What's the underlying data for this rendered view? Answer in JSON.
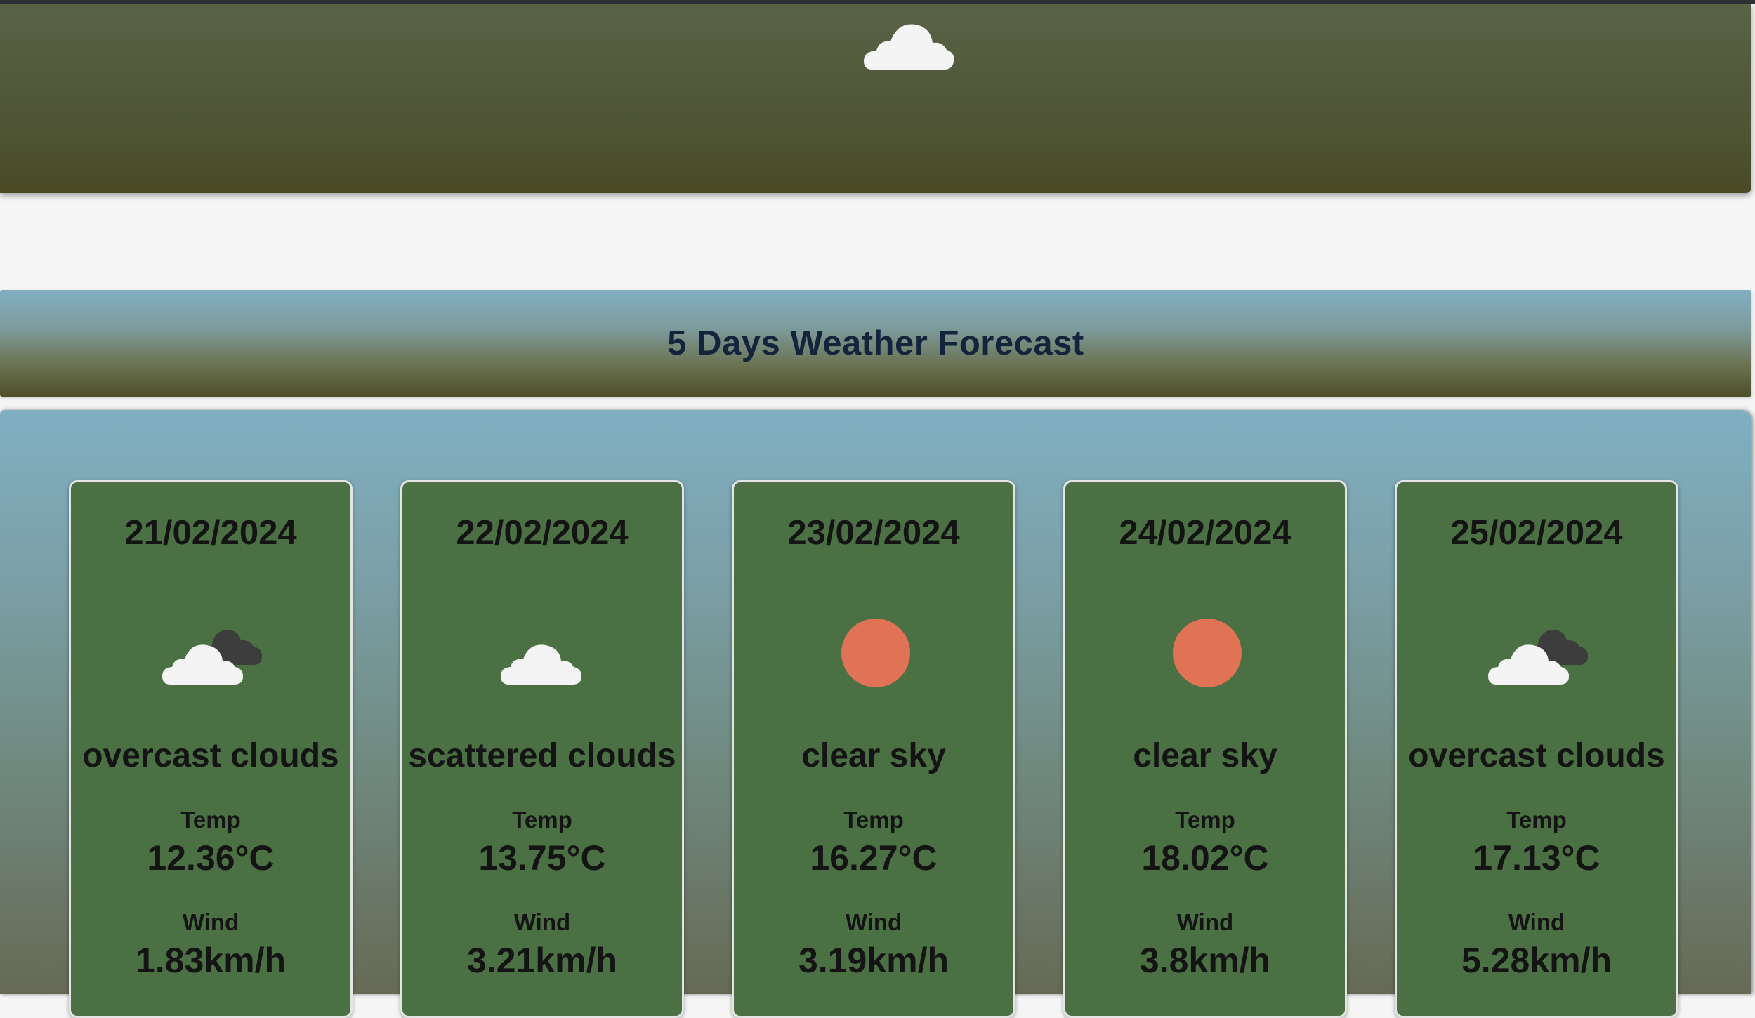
{
  "header": {
    "icon": "cloud-icon"
  },
  "title": "5 Days Weather Forecast",
  "forecast": [
    {
      "date": "21/02/2024",
      "icon": "overcast-clouds-icon",
      "description": "overcast clouds",
      "temp_label": "Temp",
      "temp": "12.36°C",
      "wind_label": "Wind",
      "wind": "1.83km/h"
    },
    {
      "date": "22/02/2024",
      "icon": "cloud-icon",
      "description": "scattered clouds",
      "temp_label": "Temp",
      "temp": "13.75°C",
      "wind_label": "Wind",
      "wind": "3.21km/h"
    },
    {
      "date": "23/02/2024",
      "icon": "sun-icon",
      "description": "clear sky",
      "temp_label": "Temp",
      "temp": "16.27°C",
      "wind_label": "Wind",
      "wind": "3.19km/h"
    },
    {
      "date": "24/02/2024",
      "icon": "sun-icon",
      "description": "clear sky",
      "temp_label": "Temp",
      "temp": "18.02°C",
      "wind_label": "Wind",
      "wind": "3.8km/h"
    },
    {
      "date": "25/02/2024",
      "icon": "overcast-clouds-icon",
      "description": "overcast clouds",
      "temp_label": "Temp",
      "temp": "17.13°C",
      "wind_label": "Wind",
      "wind": "5.28km/h"
    }
  ],
  "colors": {
    "card_background": "#4a7043",
    "sun": "#e07255",
    "cloud": "#f4f4f4",
    "dark_cloud": "#3d3d3d",
    "title_text": "#13243d"
  }
}
